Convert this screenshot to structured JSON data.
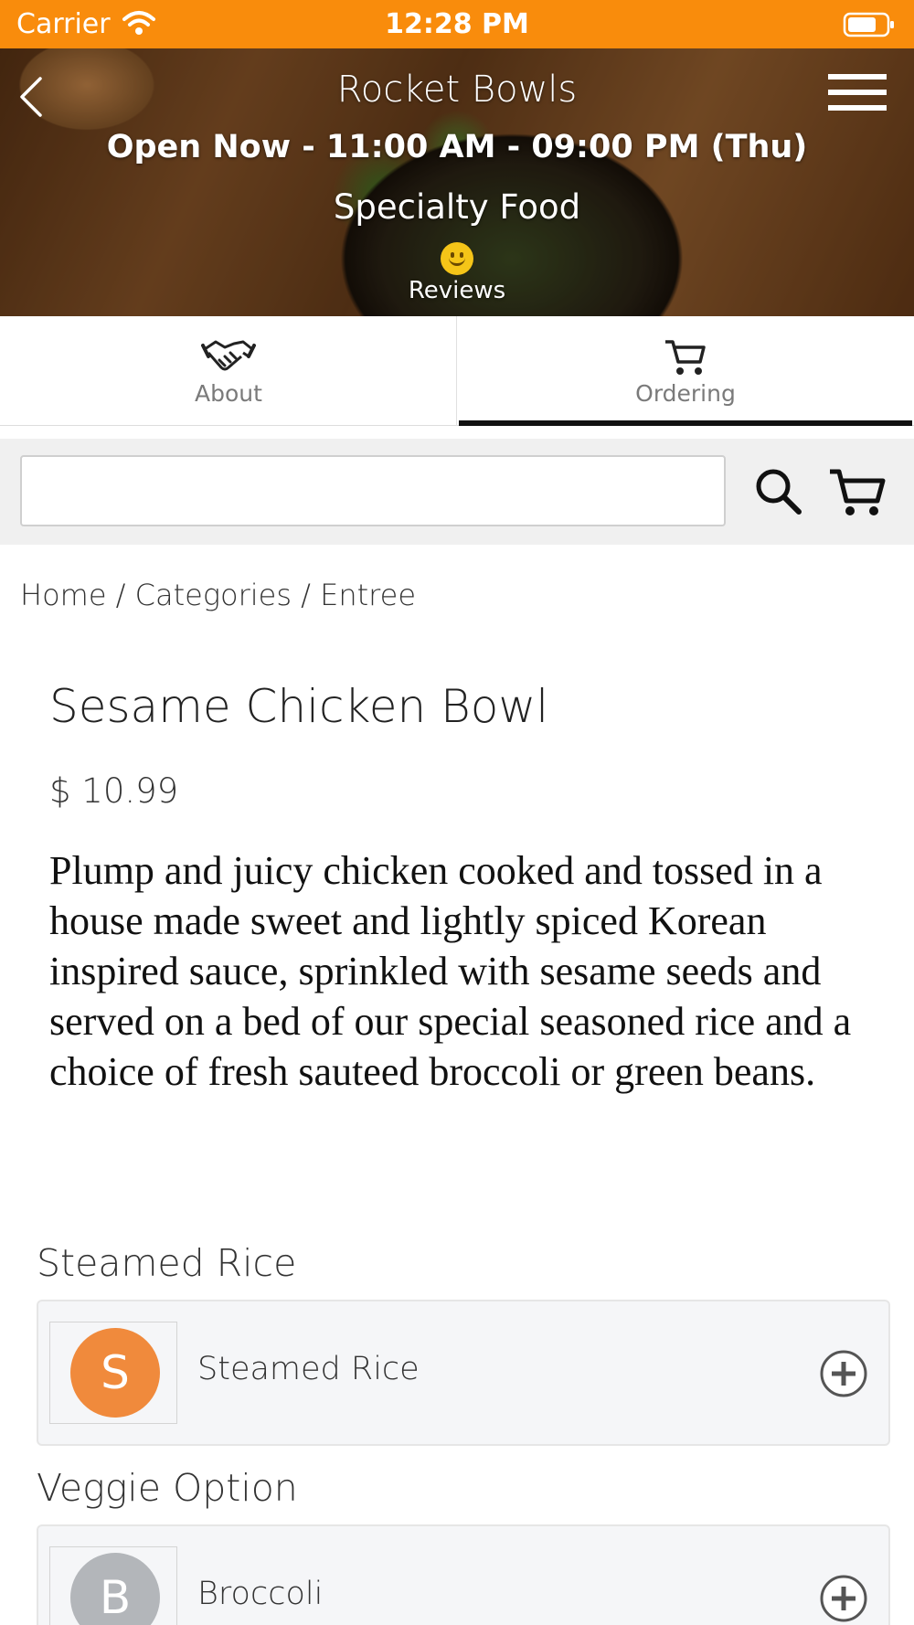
{
  "status_bar": {
    "carrier": "Carrier",
    "time": "12:28 PM"
  },
  "header": {
    "title": "Rocket Bowls",
    "hours": "Open Now - 11:00 AM - 09:00 PM (Thu)",
    "category": "Specialty Food",
    "reviews_label": "Reviews"
  },
  "tabs": [
    {
      "label": "About",
      "icon": "handshake-icon",
      "active": false
    },
    {
      "label": "Ordering",
      "icon": "cart-icon",
      "active": true
    }
  ],
  "search": {
    "value": "",
    "placeholder": ""
  },
  "breadcrumb": {
    "home": "Home",
    "categories": "Categories",
    "current": "Entree",
    "separator": "/"
  },
  "product": {
    "title": "Sesame Chicken Bowl",
    "price": "$ 10.99",
    "description": "Plump and juicy chicken cooked and tossed in a house made sweet and lightly spiced Korean inspired sauce, sprinkled with sesame seeds and served on a bed of our special seasoned rice and a choice of fresh sauteed broccoli or green beans."
  },
  "options": [
    {
      "heading": "Steamed Rice",
      "item": {
        "letter": "S",
        "name": "Steamed Rice",
        "avatar_color": "#f08a3c"
      }
    },
    {
      "heading": "Veggie Option",
      "item": {
        "letter": "B",
        "name": "Broccoli",
        "avatar_color": "#b3b6ba"
      }
    }
  ],
  "colors": {
    "status_bar": "#f98c0c",
    "tab_active_indicator": "#111111"
  }
}
